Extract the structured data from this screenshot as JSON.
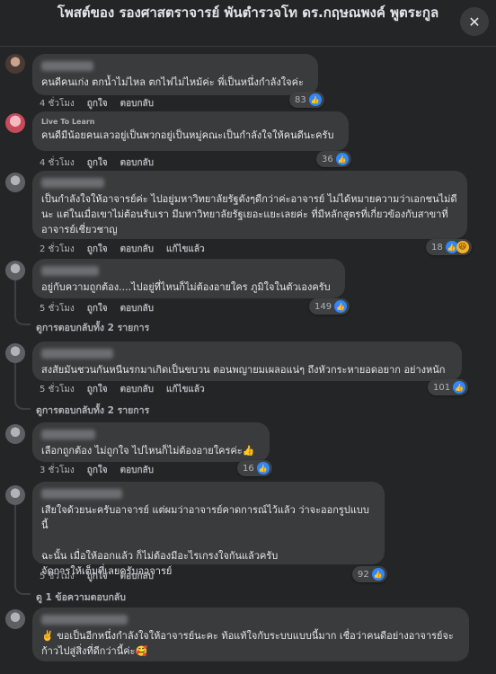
{
  "header": {
    "title": "โพสต์ของ รองศาสตราจารย์ พันตำรวจโท ดร.กฤษณพงค์ พูตระกูล",
    "close_icon": "close-icon"
  },
  "actions": {
    "like": "ถูกใจ",
    "reply": "ตอบกลับ",
    "edited": "แก้ไขแล้ว"
  },
  "comments": [
    {
      "text": "คนดีคนเก่ง ตกน้ำไม่ไหล ตกไฟไม่ไหม้ค่ะ พี่เป็นหนึ่งกำลังใจค่ะ",
      "time": "4 ชั่วโมง",
      "reactions": "83",
      "edited": false
    },
    {
      "name": "Live To Learn",
      "text": "คนดีมีน้อยคนเลวอยู่เป็นพวกอยู่เป็นหมู่คณะเป็นกำลังใจให้คนดีนะครับ",
      "time": "4 ชั่วโมง",
      "reactions": "36",
      "edited": false
    },
    {
      "text": "เป็นกำลังใจให้อาจารย์ค่ะ ไปอยู่มหาวิทยาลัยรัฐดังๆดีกว่าค่ะอาจารย์ ไม่ได้หมายความว่าเอกชนไม่ดีนะ แต่ในเมื่อเขาไม่ต้อนรับเรา มีมหาวิทยาลัยรัฐเยอะแยะเลยค่ะ ที่มีหลักสูตรที่เกี่ยวข้องกับสาขาที่อาจารย์เชี่ยวชาญ",
      "time": "2 ชั่วโมง",
      "reactions": "18",
      "edited": true
    },
    {
      "text": "อยู่กับความถูกต้อง....ไปอยู่ที่ไหนก็ไม่ต้องอายใคร ภูมิใจในตัวเองครับ",
      "time": "5 ชั่วโมง",
      "reactions": "149",
      "edited": false,
      "replies": "ดูการตอบกลับทั้ง 2 รายการ"
    },
    {
      "text": "สงสัยมันชวนกันหนีนรกมาเกิดเป็นขบวน ตอนพญายมเผลอแน่ๆ ถึงหัวกระหายอดอยาก อย่างหนัก",
      "time": "5 ชั่วโมง",
      "reactions": "101",
      "edited": true,
      "replies": "ดูการตอบกลับทั้ง 2 รายการ"
    },
    {
      "text": "เลือกถูกต้อง ไม่ถูกใจ ไปไหนก็ไม่ต้องอายใครค่ะ👍",
      "time": "3 ชั่วโมง",
      "reactions": "16",
      "edited": false
    },
    {
      "text": "เสียใจด้วยนะครับอาจารย์ แต่ผมว่าอาจารย์คาดการณ์ไว้แล้ว ว่าจะออกรูปแบบนี้\n\nฉะนั้น เมื่อให้ออกแล้ว ก็ไม่ต้องมีอะไรเกรงใจกันแล้วครับ\nจัดการให้เต็มที่เลยครับอาจารย์",
      "time": "5 ชั่วโมง",
      "reactions": "92",
      "edited": false,
      "replies": "ดู 1 ข้อความตอบกลับ"
    },
    {
      "text": "✌️ ขอเป็นอีกหนึ่งกำลังใจให้อาจารย์นะคะ ท้อแท้ใจกับระบบแบบนี้มาก เชื่อว่าคนดีอย่างอาจารย์จะก้าวไปสู่สิ่งที่ดีกว่านี้ค่ะ🥰",
      "time": "",
      "reactions": "",
      "edited": false
    }
  ]
}
